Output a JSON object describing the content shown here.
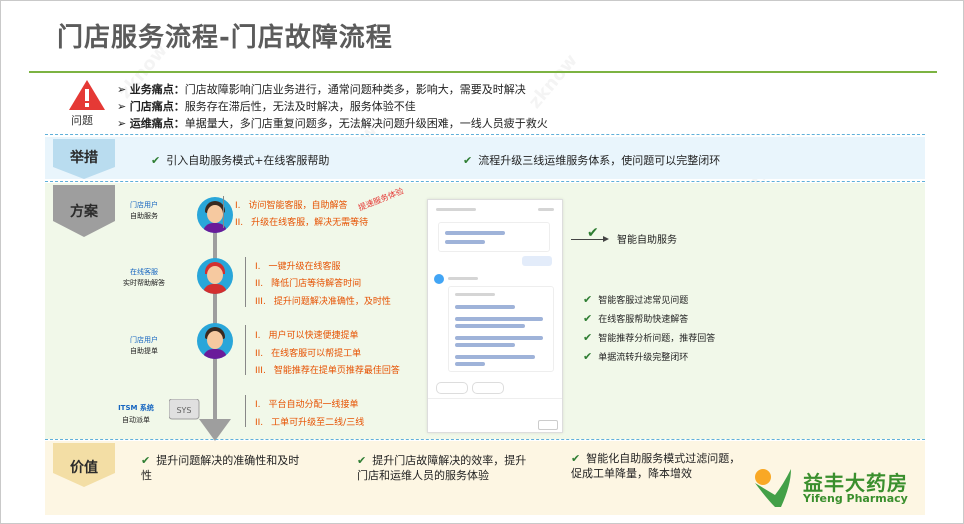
{
  "header": {
    "title": "门店服务流程-门店故障流程"
  },
  "problem": {
    "label": "问题",
    "items": [
      {
        "key": "业务痛点：",
        "text": "门店故障影响门店业务进行，通常问题种类多，影响大，需要及时解决"
      },
      {
        "key": "门店痛点：",
        "text": "服务存在滞后性，无法及时解决，服务体验不佳"
      },
      {
        "key": "运维痛点：",
        "text": "单据量大，多门店重复问题多，无法解决问题升级困难，一线人员疲于救火"
      }
    ]
  },
  "measures": {
    "label": "举措",
    "items": [
      "引入自助服务模式+在线客服帮助",
      "流程升级三线运维服务体系，使问题可以完整闭环"
    ]
  },
  "solution": {
    "label": "方案",
    "actors": [
      {
        "role": "门店用户",
        "desc": "自助服务"
      },
      {
        "role": "在线客服",
        "desc": "实时帮助解答"
      },
      {
        "role": "门店用户",
        "desc": "自助提单"
      },
      {
        "role": "ITSM 系统",
        "desc": "自动派单"
      }
    ],
    "groups": [
      {
        "steps": [
          {
            "num": "I.",
            "text": "访问智能客服，自助解答"
          },
          {
            "num": "II.",
            "text": "升级在线客服，解决无需等待"
          }
        ]
      },
      {
        "steps": [
          {
            "num": "I.",
            "text": "一键升级在线客服"
          },
          {
            "num": "II.",
            "text": "降低门店等待解答时间"
          },
          {
            "num": "III.",
            "text": "提升问题解决准确性，及时性"
          }
        ]
      },
      {
        "steps": [
          {
            "num": "I.",
            "text": "用户可以快速便捷提单"
          },
          {
            "num": "II.",
            "text": "在线客服可以帮提工单"
          },
          {
            "num": "III.",
            "text": "智能推荐在提单页推荐最佳回答"
          }
        ]
      },
      {
        "steps": [
          {
            "num": "I.",
            "text": "平台自动分配一线接单"
          },
          {
            "num": "II.",
            "text": "工单可升级至二线/三线"
          }
        ]
      }
    ],
    "stamp": "提速服务体验",
    "sys_label": "SYS",
    "self_service": "智能自助服务",
    "benefits": [
      "智能客服过滤常见问题",
      "在线客服帮助快速解答",
      "智能推荐分析问题，推荐回答",
      "单据流转升级完整闭环"
    ]
  },
  "value": {
    "label": "价值",
    "items": [
      "提升问题解决的准确性和及时性",
      "提升门店故障解决的效率，提升门店和运维人员的服务体验",
      "智能化自助服务模式过滤问题，促成工单降量，降本增效"
    ]
  },
  "brand": {
    "cn": "益丰大药房",
    "en": "Yifeng Pharmacy"
  },
  "colors": {
    "accent_green": "#7cb342",
    "step_orange": "#e65100",
    "band_blue": "#e9f5fc",
    "band_green": "#f1f8e9",
    "band_yellow": "#fdf6e3"
  }
}
